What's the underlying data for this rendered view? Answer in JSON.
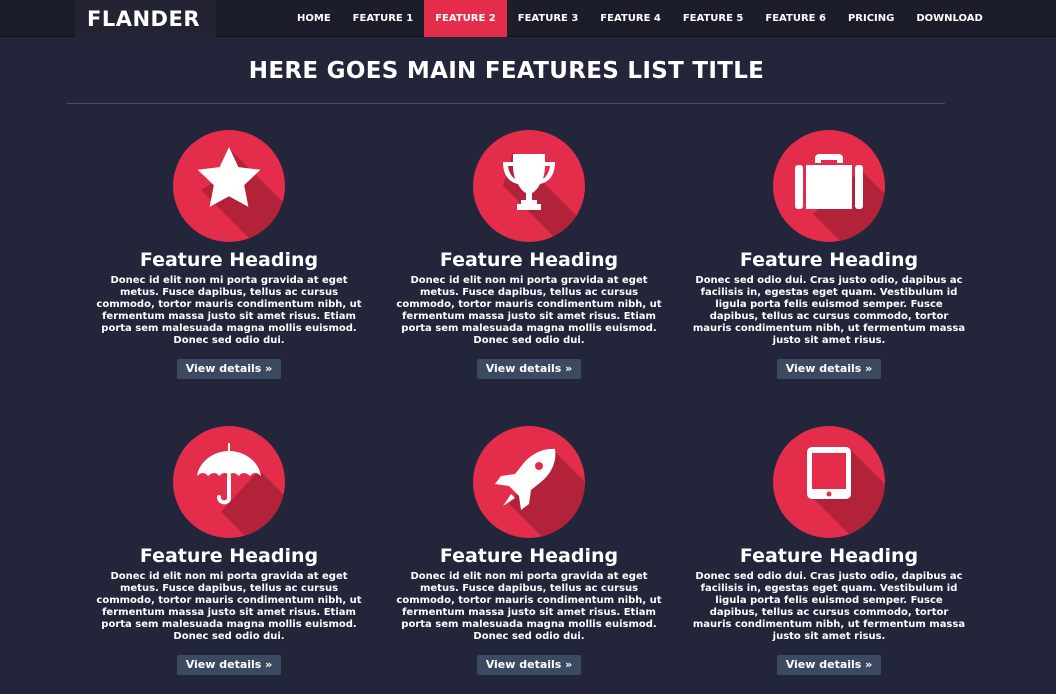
{
  "brand": "FLANDER",
  "nav": [
    {
      "label": "HOME",
      "active": false
    },
    {
      "label": "FEATURE 1",
      "active": false
    },
    {
      "label": "FEATURE 2",
      "active": true
    },
    {
      "label": "FEATURE 3",
      "active": false
    },
    {
      "label": "FEATURE 4",
      "active": false
    },
    {
      "label": "FEATURE 5",
      "active": false
    },
    {
      "label": "FEATURE 6",
      "active": false
    },
    {
      "label": "PRICING",
      "active": false
    },
    {
      "label": "DOWNLOAD",
      "active": false
    }
  ],
  "main": {
    "title": "HERE GOES MAIN FEATURES LIST TITLE"
  },
  "colors": {
    "background": "#23263a",
    "navbar": "#1b1d2b",
    "accent": "#e42d4b",
    "button": "#3c4a61"
  },
  "features": [
    {
      "icon": "star-icon",
      "heading": "Feature Heading",
      "text": "Donec id elit non mi porta gravida at eget metus. Fusce dapibus, tellus ac cursus commodo, tortor mauris condimentum nibh, ut fermentum massa justo sit amet risus. Etiam porta sem malesuada magna mollis euismod. Donec sed odio dui.",
      "button": "View details »"
    },
    {
      "icon": "trophy-icon",
      "heading": "Feature Heading",
      "text": "Donec id elit non mi porta gravida at eget metus. Fusce dapibus, tellus ac cursus commodo, tortor mauris condimentum nibh, ut fermentum massa justo sit amet risus. Etiam porta sem malesuada magna mollis euismod. Donec sed odio dui.",
      "button": "View details »"
    },
    {
      "icon": "briefcase-icon",
      "heading": "Feature Heading",
      "text": "Donec sed odio dui. Cras justo odio, dapibus ac facilisis in, egestas eget quam. Vestibulum id ligula porta felis euismod semper. Fusce dapibus, tellus ac cursus commodo, tortor mauris condimentum nibh, ut fermentum massa justo sit amet risus.",
      "button": "View details »"
    },
    {
      "icon": "umbrella-icon",
      "heading": "Feature Heading",
      "text": "Donec id elit non mi porta gravida at eget metus. Fusce dapibus, tellus ac cursus commodo, tortor mauris condimentum nibh, ut fermentum massa justo sit amet risus. Etiam porta sem malesuada magna mollis euismod. Donec sed odio dui.",
      "button": "View details »"
    },
    {
      "icon": "rocket-icon",
      "heading": "Feature Heading",
      "text": "Donec id elit non mi porta gravida at eget metus. Fusce dapibus, tellus ac cursus commodo, tortor mauris condimentum nibh, ut fermentum massa justo sit amet risus. Etiam porta sem malesuada magna mollis euismod. Donec sed odio dui.",
      "button": "View details »"
    },
    {
      "icon": "tablet-icon",
      "heading": "Feature Heading",
      "text": "Donec sed odio dui. Cras justo odio, dapibus ac facilisis in, egestas eget quam. Vestibulum id ligula porta felis euismod semper. Fusce dapibus, tellus ac cursus commodo, tortor mauris condimentum nibh, ut fermentum massa justo sit amet risus.",
      "button": "View details »"
    }
  ]
}
